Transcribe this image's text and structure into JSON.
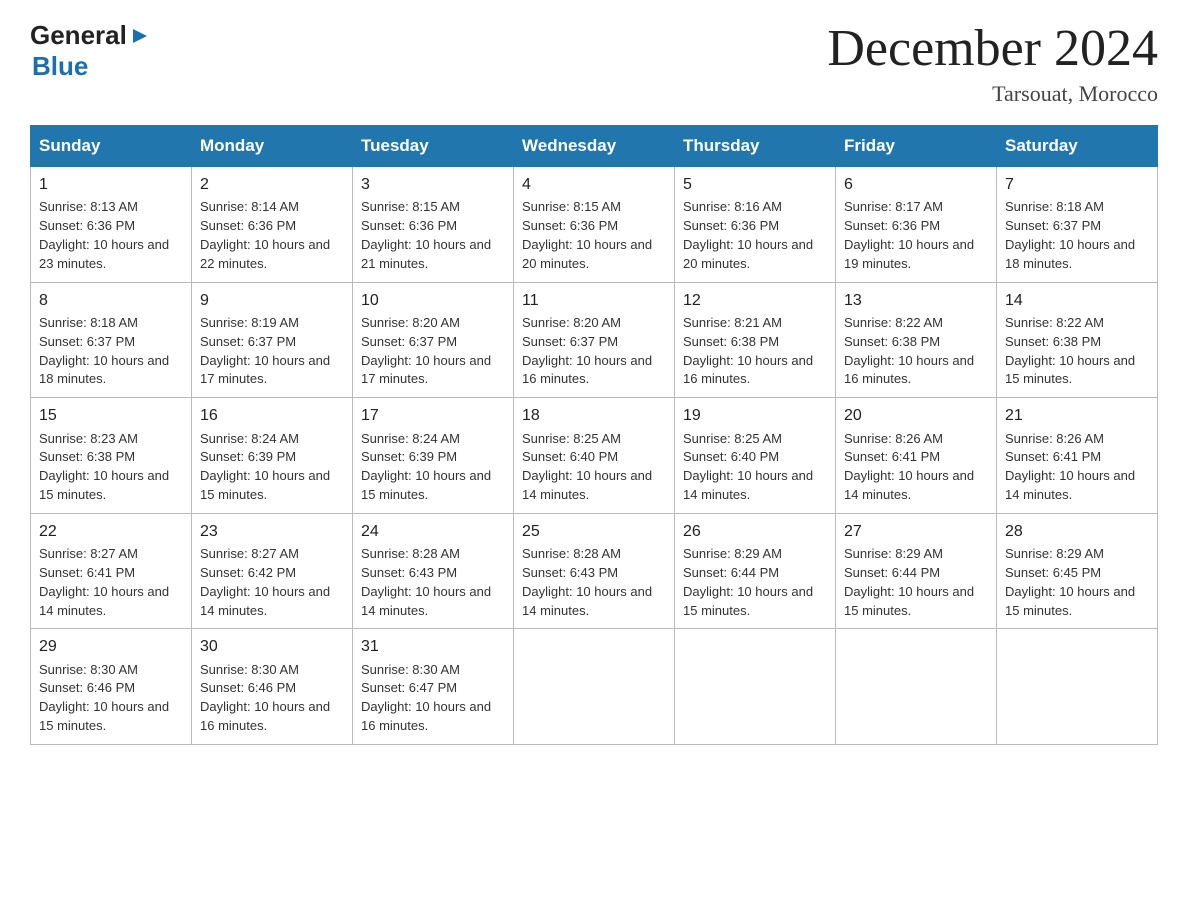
{
  "header": {
    "logo_general": "General",
    "logo_blue": "Blue",
    "title": "December 2024",
    "subtitle": "Tarsouat, Morocco"
  },
  "weekdays": [
    "Sunday",
    "Monday",
    "Tuesday",
    "Wednesday",
    "Thursday",
    "Friday",
    "Saturday"
  ],
  "weeks": [
    [
      {
        "day": "1",
        "sunrise": "8:13 AM",
        "sunset": "6:36 PM",
        "daylight": "10 hours and 23 minutes."
      },
      {
        "day": "2",
        "sunrise": "8:14 AM",
        "sunset": "6:36 PM",
        "daylight": "10 hours and 22 minutes."
      },
      {
        "day": "3",
        "sunrise": "8:15 AM",
        "sunset": "6:36 PM",
        "daylight": "10 hours and 21 minutes."
      },
      {
        "day": "4",
        "sunrise": "8:15 AM",
        "sunset": "6:36 PM",
        "daylight": "10 hours and 20 minutes."
      },
      {
        "day": "5",
        "sunrise": "8:16 AM",
        "sunset": "6:36 PM",
        "daylight": "10 hours and 20 minutes."
      },
      {
        "day": "6",
        "sunrise": "8:17 AM",
        "sunset": "6:36 PM",
        "daylight": "10 hours and 19 minutes."
      },
      {
        "day": "7",
        "sunrise": "8:18 AM",
        "sunset": "6:37 PM",
        "daylight": "10 hours and 18 minutes."
      }
    ],
    [
      {
        "day": "8",
        "sunrise": "8:18 AM",
        "sunset": "6:37 PM",
        "daylight": "10 hours and 18 minutes."
      },
      {
        "day": "9",
        "sunrise": "8:19 AM",
        "sunset": "6:37 PM",
        "daylight": "10 hours and 17 minutes."
      },
      {
        "day": "10",
        "sunrise": "8:20 AM",
        "sunset": "6:37 PM",
        "daylight": "10 hours and 17 minutes."
      },
      {
        "day": "11",
        "sunrise": "8:20 AM",
        "sunset": "6:37 PM",
        "daylight": "10 hours and 16 minutes."
      },
      {
        "day": "12",
        "sunrise": "8:21 AM",
        "sunset": "6:38 PM",
        "daylight": "10 hours and 16 minutes."
      },
      {
        "day": "13",
        "sunrise": "8:22 AM",
        "sunset": "6:38 PM",
        "daylight": "10 hours and 16 minutes."
      },
      {
        "day": "14",
        "sunrise": "8:22 AM",
        "sunset": "6:38 PM",
        "daylight": "10 hours and 15 minutes."
      }
    ],
    [
      {
        "day": "15",
        "sunrise": "8:23 AM",
        "sunset": "6:38 PM",
        "daylight": "10 hours and 15 minutes."
      },
      {
        "day": "16",
        "sunrise": "8:24 AM",
        "sunset": "6:39 PM",
        "daylight": "10 hours and 15 minutes."
      },
      {
        "day": "17",
        "sunrise": "8:24 AM",
        "sunset": "6:39 PM",
        "daylight": "10 hours and 15 minutes."
      },
      {
        "day": "18",
        "sunrise": "8:25 AM",
        "sunset": "6:40 PM",
        "daylight": "10 hours and 14 minutes."
      },
      {
        "day": "19",
        "sunrise": "8:25 AM",
        "sunset": "6:40 PM",
        "daylight": "10 hours and 14 minutes."
      },
      {
        "day": "20",
        "sunrise": "8:26 AM",
        "sunset": "6:41 PM",
        "daylight": "10 hours and 14 minutes."
      },
      {
        "day": "21",
        "sunrise": "8:26 AM",
        "sunset": "6:41 PM",
        "daylight": "10 hours and 14 minutes."
      }
    ],
    [
      {
        "day": "22",
        "sunrise": "8:27 AM",
        "sunset": "6:41 PM",
        "daylight": "10 hours and 14 minutes."
      },
      {
        "day": "23",
        "sunrise": "8:27 AM",
        "sunset": "6:42 PM",
        "daylight": "10 hours and 14 minutes."
      },
      {
        "day": "24",
        "sunrise": "8:28 AM",
        "sunset": "6:43 PM",
        "daylight": "10 hours and 14 minutes."
      },
      {
        "day": "25",
        "sunrise": "8:28 AM",
        "sunset": "6:43 PM",
        "daylight": "10 hours and 14 minutes."
      },
      {
        "day": "26",
        "sunrise": "8:29 AM",
        "sunset": "6:44 PM",
        "daylight": "10 hours and 15 minutes."
      },
      {
        "day": "27",
        "sunrise": "8:29 AM",
        "sunset": "6:44 PM",
        "daylight": "10 hours and 15 minutes."
      },
      {
        "day": "28",
        "sunrise": "8:29 AM",
        "sunset": "6:45 PM",
        "daylight": "10 hours and 15 minutes."
      }
    ],
    [
      {
        "day": "29",
        "sunrise": "8:30 AM",
        "sunset": "6:46 PM",
        "daylight": "10 hours and 15 minutes."
      },
      {
        "day": "30",
        "sunrise": "8:30 AM",
        "sunset": "6:46 PM",
        "daylight": "10 hours and 16 minutes."
      },
      {
        "day": "31",
        "sunrise": "8:30 AM",
        "sunset": "6:47 PM",
        "daylight": "10 hours and 16 minutes."
      },
      null,
      null,
      null,
      null
    ]
  ]
}
